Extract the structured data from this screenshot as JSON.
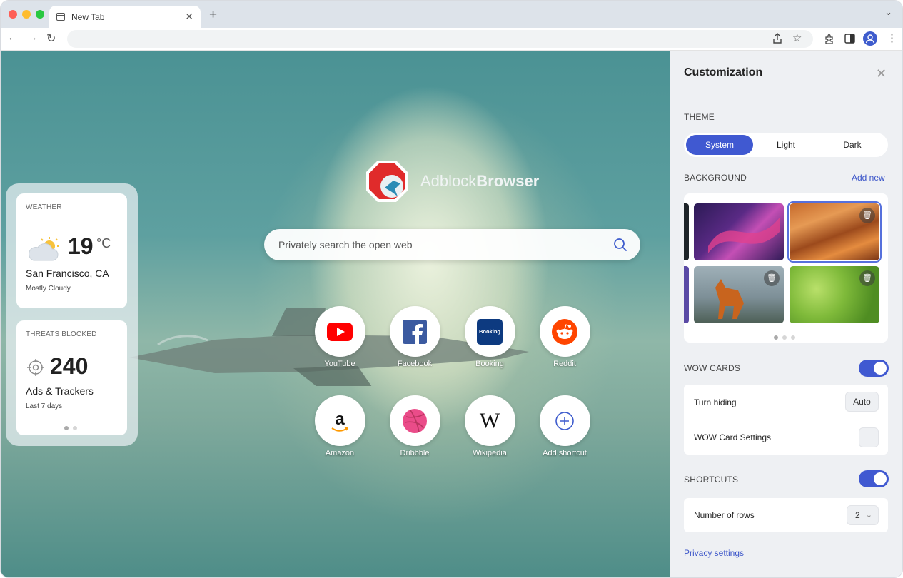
{
  "browser": {
    "tab_title": "New Tab",
    "address": ""
  },
  "newtab": {
    "brand_light": "Adblock",
    "brand_bold": "Browser",
    "search_placeholder": "Privately search the open web",
    "shortcuts": [
      {
        "label": "YouTube",
        "icon": "youtube-icon"
      },
      {
        "label": "Facebook",
        "icon": "facebook-icon"
      },
      {
        "label": "Booking",
        "icon": "booking-icon",
        "icon_text": "Booking"
      },
      {
        "label": "Reddit",
        "icon": "reddit-icon"
      },
      {
        "label": "Amazon",
        "icon": "amazon-icon",
        "icon_text": "a"
      },
      {
        "label": "Dribbble",
        "icon": "dribbble-icon"
      },
      {
        "label": "Wikipedia",
        "icon": "wikipedia-icon",
        "icon_text": "W"
      },
      {
        "label": "Add shortcut",
        "icon": "plus-icon"
      }
    ]
  },
  "widgets": {
    "weather": {
      "label": "WEATHER",
      "temp": "19",
      "unit": "°C",
      "city": "San Francisco, CA",
      "condition": "Mostly Cloudy"
    },
    "threats": {
      "label": "THREATS BLOCKED",
      "count": "240",
      "title": "Ads & Trackers",
      "period": "Last 7 days"
    }
  },
  "panel": {
    "title": "Customization",
    "theme": {
      "label": "THEME",
      "options": [
        "System",
        "Light",
        "Dark"
      ],
      "selected": "System"
    },
    "background": {
      "label": "BACKGROUND",
      "add_label": "Add new"
    },
    "wow_cards": {
      "label": "WOW CARDS",
      "enabled": true,
      "turn_hiding_label": "Turn hiding",
      "turn_hiding_value": "Auto",
      "settings_label": "WOW Card Settings"
    },
    "shortcuts": {
      "label": "SHORTCUTS",
      "enabled": true,
      "rows_label": "Number of rows",
      "rows_value": "2"
    },
    "privacy_link": "Privacy settings"
  },
  "colors": {
    "accent": "#4059d1",
    "link": "#3c56c9"
  }
}
